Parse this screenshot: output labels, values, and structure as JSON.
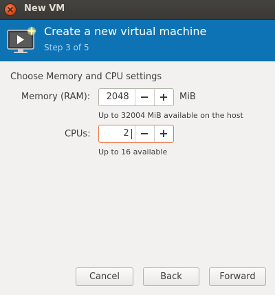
{
  "window": {
    "title": "New VM"
  },
  "header": {
    "title": "Create a new virtual machine",
    "step": "Step 3 of 5"
  },
  "section": {
    "title": "Choose Memory and CPU settings"
  },
  "memory": {
    "label": "Memory (RAM):",
    "value": "2048",
    "unit": "MiB",
    "hint": "Up to 32004 MiB available on the host",
    "decrement_icon": "minus-icon",
    "increment_icon": "plus-icon"
  },
  "cpus": {
    "label": "CPUs:",
    "value": "2",
    "hint": "Up to 16 available",
    "decrement_icon": "minus-icon",
    "increment_icon": "plus-icon"
  },
  "buttons": {
    "cancel": "Cancel",
    "back": "Back",
    "forward": "Forward"
  },
  "colors": {
    "header_bg": "#0d73b5",
    "step_text": "#a9d4f5",
    "focus_border": "#f07746",
    "close_button": "#df4a16"
  }
}
